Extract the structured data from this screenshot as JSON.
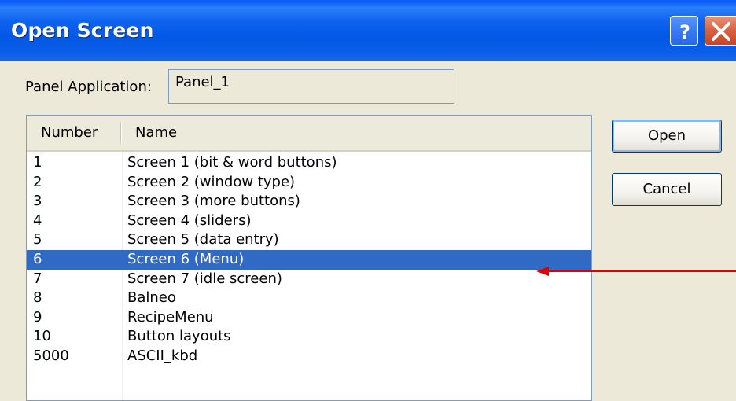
{
  "window": {
    "title": "Open Screen",
    "help_icon": "help-icon",
    "close_icon": "close-icon"
  },
  "panel_application": {
    "label": "Panel Application:",
    "value": "Panel_1"
  },
  "list": {
    "columns": [
      "Number",
      "Name"
    ],
    "rows": [
      {
        "number": "1",
        "name": "Screen 1 (bit & word buttons)"
      },
      {
        "number": "2",
        "name": "Screen 2 (window type)"
      },
      {
        "number": "3",
        "name": "Screen 3 (more buttons)"
      },
      {
        "number": "4",
        "name": "Screen 4 (sliders)"
      },
      {
        "number": "5",
        "name": "Screen 5 (data entry)"
      },
      {
        "number": "6",
        "name": "Screen 6 (Menu)"
      },
      {
        "number": "7",
        "name": "Screen 7 (idle screen)"
      },
      {
        "number": "8",
        "name": "Balneo"
      },
      {
        "number": "9",
        "name": "RecipeMenu"
      },
      {
        "number": "10",
        "name": "Button layouts"
      },
      {
        "number": "5000",
        "name": "ASCII_kbd"
      }
    ],
    "selected_index": 5
  },
  "buttons": {
    "open_label": "Open",
    "cancel_label": "Cancel"
  },
  "colors": {
    "selection": "#316ac5",
    "arrow": "#e00000",
    "titlebar": "#0257e4"
  }
}
